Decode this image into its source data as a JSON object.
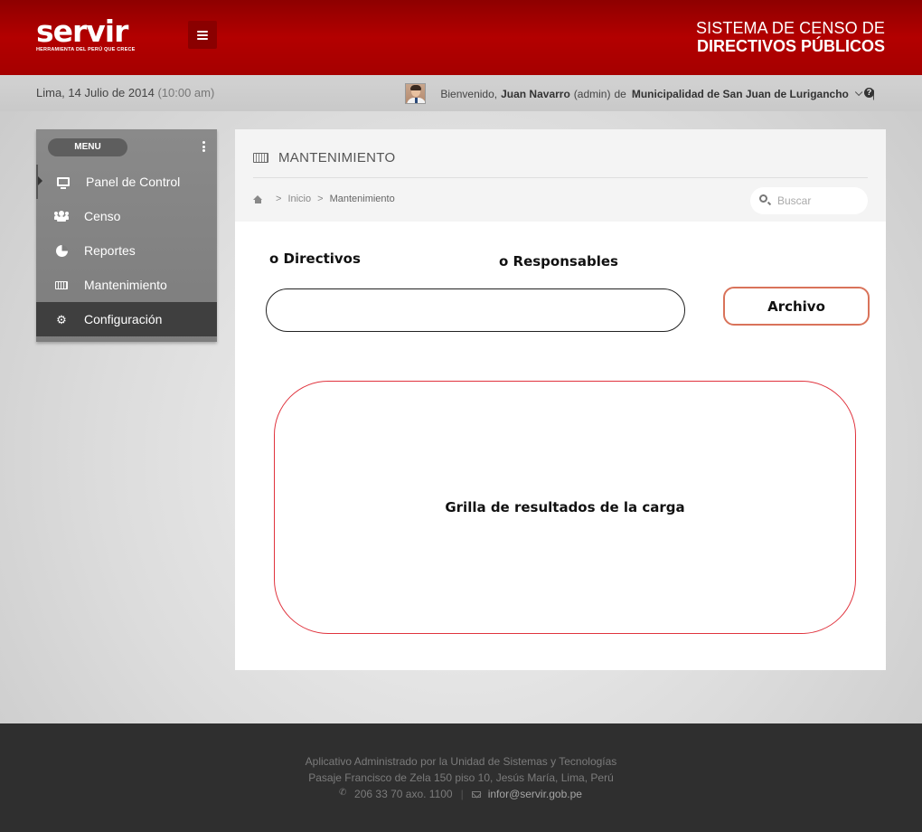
{
  "header": {
    "logo_text": "servir",
    "logo_subtitle": "HERRAMIENTA DEL PERÚ QUE CRECE",
    "system_title_line1": "SISTEMA DE CENSO  DE",
    "system_title_line2": "DIRECTIVOS PÚBLICOS",
    "brand_color": "#b30000"
  },
  "infobar": {
    "date": "Lima, 14 Julio de 2014",
    "time": "(10:00 am)",
    "welcome": "Bienvenido,",
    "user_name": "Juan Navarro",
    "user_role": "(admin)",
    "connector": "de",
    "organization": "Municipalidad de San Juan de Lurigancho",
    "separator": "|",
    "help_icon": "?"
  },
  "sidebar": {
    "menu_label": "MENU",
    "items": [
      {
        "label": "Panel de Control",
        "icon": "monitor-icon"
      },
      {
        "label": "Censo",
        "icon": "users-icon"
      },
      {
        "label": "Reportes",
        "icon": "pie-chart-icon"
      },
      {
        "label": "Mantenimiento",
        "icon": "keyboard-icon"
      },
      {
        "label": "Configuración",
        "icon": "gears-icon",
        "selected": true
      }
    ]
  },
  "main": {
    "title": "MANTENIMIENTO",
    "breadcrumb": {
      "home": "Inicio",
      "current": "Mantenimiento",
      "separator": ">"
    },
    "search_placeholder": "Buscar",
    "radio_directivos": "o Directivos",
    "radio_responsables": "o Responsables",
    "archivo_button": "Archivo",
    "results_grid_label": "Grilla de resultados de la carga"
  },
  "footer": {
    "line1": "Aplicativo Administrado por la Unidad de Sistemas y Tecnologías",
    "line2": "Pasaje Francisco de Zela 150 piso 10, Jesús María, Lima, Perú",
    "phone": "206 33 70 axo. 1100",
    "divider": "|",
    "email": "infor@servir.gob.pe"
  }
}
